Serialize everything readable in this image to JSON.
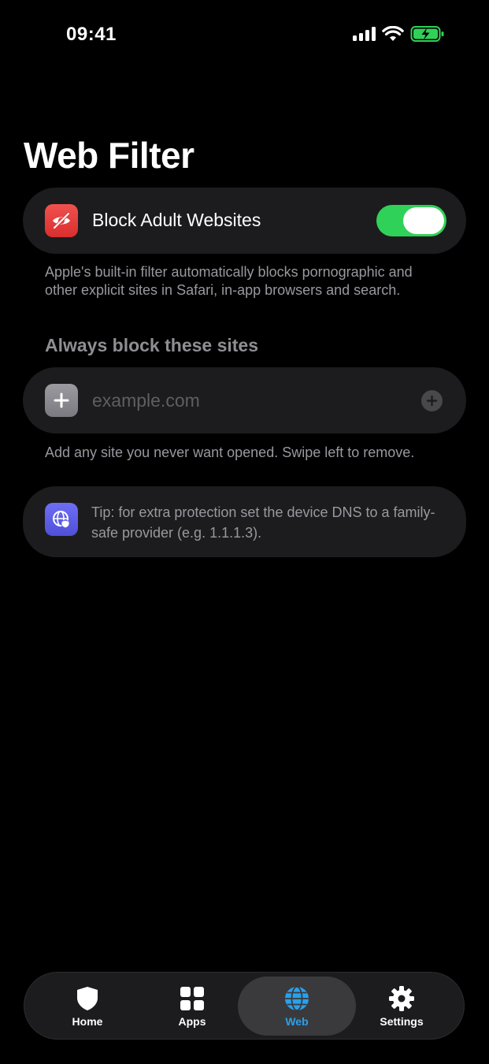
{
  "status_bar": {
    "time": "09:41"
  },
  "page": {
    "title": "Web Filter"
  },
  "adult_filter": {
    "label": "Block Adult Websites",
    "enabled": true,
    "footnote": "Apple's built-in filter automatically blocks pornographic and other explicit sites in Safari, in-app browsers and search."
  },
  "block_list": {
    "header": "Always block these sites",
    "input_placeholder": "example.com",
    "input_value": "",
    "footnote": "Add any site you never want opened. Swipe left to remove."
  },
  "tip": {
    "text": "Tip: for extra protection set the device DNS to a family-safe provider (e.g. 1.1.1.3)."
  },
  "tabbar": {
    "tabs": [
      {
        "label": "Home",
        "icon": "shield-icon",
        "active": false
      },
      {
        "label": "Apps",
        "icon": "grid-icon",
        "active": false
      },
      {
        "label": "Web",
        "icon": "globe-icon",
        "active": true
      },
      {
        "label": "Settings",
        "icon": "gear-icon",
        "active": false
      }
    ]
  },
  "colors": {
    "background": "#000000",
    "card": "#1c1c1e",
    "toggle_on": "#30d158",
    "active_tab": "#2aa0ea",
    "battery": "#30d158"
  }
}
